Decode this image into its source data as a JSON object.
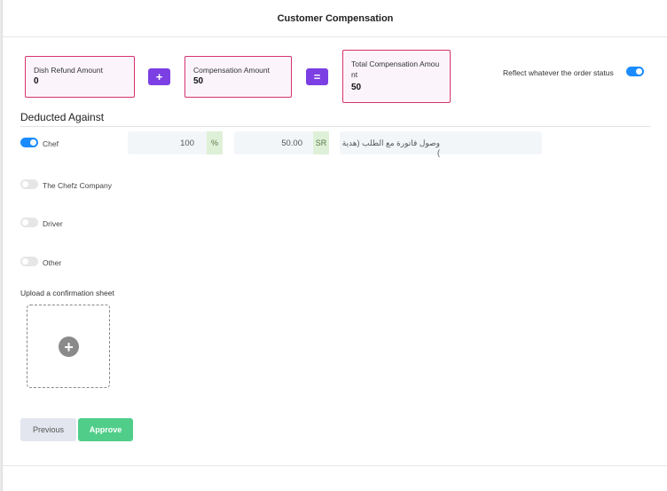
{
  "modal": {
    "title": "Customer Compensation"
  },
  "amounts": {
    "dish_refund": {
      "label": "Dish Refund Amount",
      "value": "0"
    },
    "compensation": {
      "label": "Compensation Amount",
      "value": "50"
    },
    "total": {
      "label": "Total Compensation Amou nt",
      "value": "50"
    },
    "plus_symbol": "+",
    "equals_symbol": "="
  },
  "reflect": {
    "label": "Reflect whatever the order status",
    "enabled": true
  },
  "deducted": {
    "title": "Deducted Against",
    "rows": [
      {
        "label": "Chef",
        "enabled": true,
        "percent": "100",
        "percent_suffix": "%",
        "amount": "50.00",
        "amount_suffix": "SR",
        "note": "وصول فاتورة مع الطلب (هدية )"
      },
      {
        "label": "The Chefz Company",
        "enabled": false
      },
      {
        "label": "Driver",
        "enabled": false
      },
      {
        "label": "Other",
        "enabled": false
      }
    ]
  },
  "upload": {
    "label": "Upload a confirmation sheet",
    "icon": "plus-circle-icon"
  },
  "buttons": {
    "previous": "Previous",
    "approve": "Approve"
  },
  "colors": {
    "accent_purple": "#7b3fe4",
    "toggle_blue": "#1a8cff",
    "approve_green": "#50cd89",
    "border_pink": "#d6336c"
  }
}
